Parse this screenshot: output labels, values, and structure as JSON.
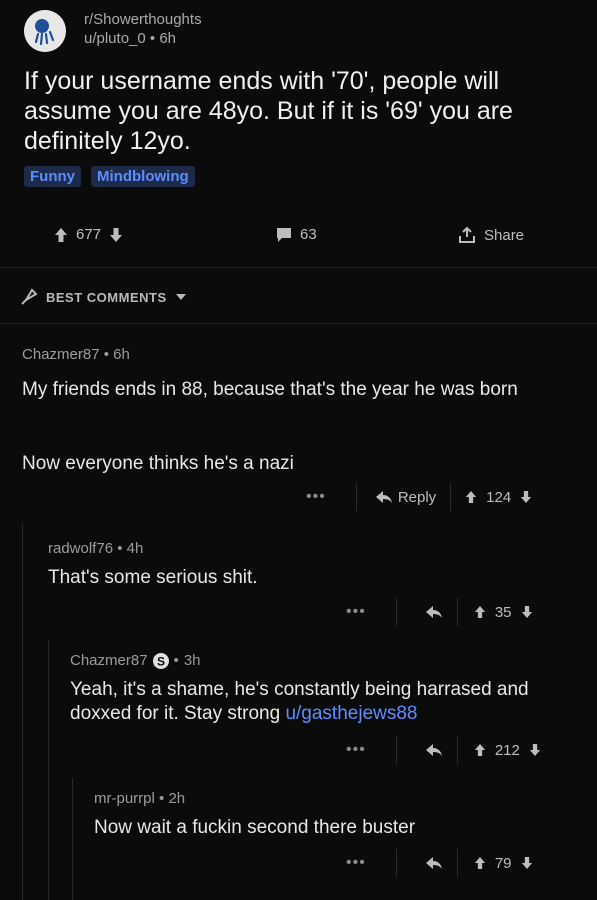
{
  "post": {
    "subreddit": "r/Showerthoughts",
    "author": "u/pluto_0",
    "age": "6h",
    "title": "If your username ends with '70', people will assume you are 48yo. But if it is '69' you are definitely 12yo.",
    "tags": [
      "Funny",
      "Mindblowing"
    ],
    "votes": "677",
    "comments": "63",
    "share_label": "Share"
  },
  "sort": {
    "label": "BEST COMMENTS"
  },
  "comments": [
    {
      "author": "Chazmer87",
      "age": "6h",
      "body_p1": "My friends ends in 88, because that's the year he was born",
      "body_p2": "Now everyone thinks he's a nazi",
      "reply_label": "Reply",
      "score": "124"
    },
    {
      "author": "radwolf76",
      "age": "4h",
      "body": "That's some serious shit.",
      "score": "35"
    },
    {
      "author": "Chazmer87",
      "age": "3h",
      "body": "Yeah, it's a shame, he's constantly being harrased and doxxed for it. Stay strong ",
      "mention": "u/gasthejews88",
      "score": "212"
    },
    {
      "author": "mr-purrpl",
      "age": "2h",
      "body": "Now wait a fuckin second there buster",
      "score": "79"
    }
  ],
  "ui": {
    "more": "•••",
    "sep": "•"
  },
  "colors": {
    "accent": "#5c8dff",
    "background": "#0b0b0b",
    "tag_bg": "#1d2a4a"
  },
  "icons": [
    "subreddit-avatar-icon",
    "upvote-icon",
    "downvote-icon",
    "comment-icon",
    "share-icon",
    "best-sort-icon",
    "reply-icon",
    "op-badge-icon"
  ]
}
